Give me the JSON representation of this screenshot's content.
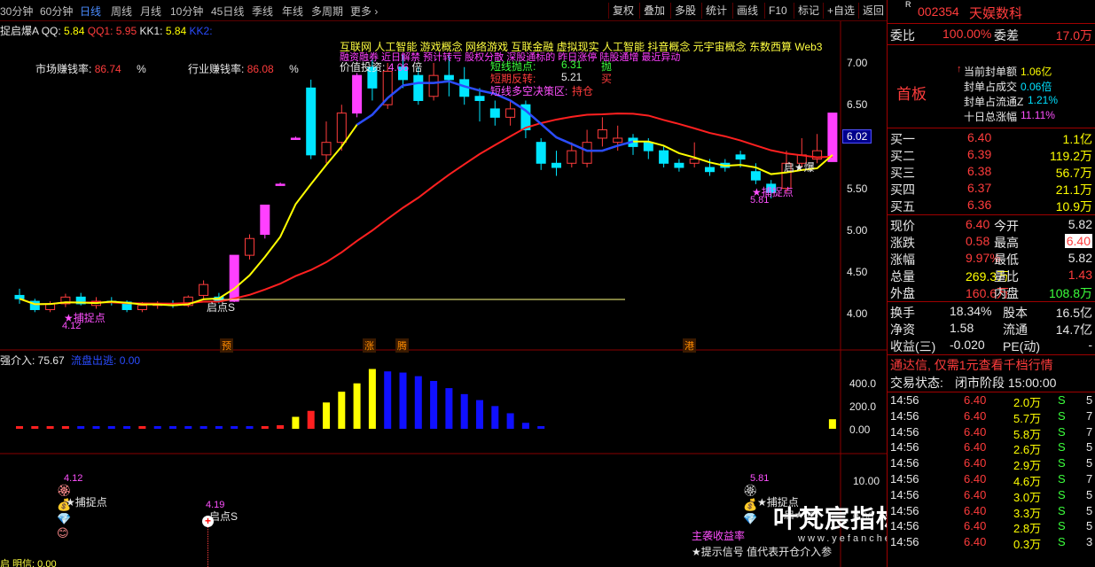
{
  "toolbar": {
    "periods": [
      "30分钟",
      "60分钟",
      "日线",
      "周线",
      "月线",
      "10分钟",
      "45日线",
      "季线",
      "年线",
      "多周期",
      "更多"
    ],
    "buttons": [
      "复权",
      "叠加",
      "多股",
      "统计",
      "画线",
      "F10",
      "标记",
      "+自选",
      "返回"
    ]
  },
  "main_header": {
    "indicator_name": "捉启爆A",
    "qq_label": "QQ:",
    "qq_value": "5.84",
    "qq1_label": "QQ1:",
    "qq1_value": "5.95",
    "kk1_label": "KK1:",
    "kk1_value": "5.84",
    "kk2_label": "KK2:"
  },
  "market": {
    "market_label": "市场赚钱率:",
    "market_value": "86.74",
    "market_unit": "%",
    "industry_label": "行业赚钱率:",
    "industry_value": "86.08",
    "industry_unit": "%"
  },
  "concepts": {
    "line1": "互联网  人工智能  游戏概念  网络游戏  互联金融  虚拟现实  人工智能  抖音概念  元宇宙概念  东数西算  Web3",
    "line2": "融资融券  近日解禁  预计转亏  股权分散  深股通标的  昨日涨停  陆股通增  最近异动",
    "value_label": "价值投资:",
    "value_num": "4.06",
    "value_suffix": "倍"
  },
  "signal_box": {
    "row1_label": "短线抛点:",
    "row1_value": "6.31",
    "row1_tag": "抛",
    "row2_label": "短期反转:",
    "row2_value": "5.21",
    "row2_tag": "买",
    "row3_label": "短线多空决策区:",
    "row3_value": "持仓"
  },
  "price_axis": [
    "7.00",
    "6.50",
    "6.02",
    "5.50",
    "5.00",
    "4.50",
    "4.00"
  ],
  "price_axis_highlight": "6.02",
  "annotations": {
    "catch_point_left": "★捕捉点",
    "catch_point_left_val": "4.12",
    "start_s": "启点S",
    "catch_point_right": "★捕捉点",
    "catch_point_right_val": "5.81",
    "start_burst": "启★爆",
    "markers": [
      "预",
      "涨",
      "腾",
      "港"
    ]
  },
  "volume_panel": {
    "label": "强介入: 75.67",
    "label2": "流盘出逃: 0.00",
    "axis": [
      "400.0",
      "200.0",
      "0.00"
    ]
  },
  "bottom_panel": {
    "left_val": "4.12",
    "left_label": "★捕捉点",
    "mid_val": "4.19",
    "mid_label": "启点S",
    "right_val": "5.81",
    "right_label": "★捕捉点",
    "right_tag": "启★爆",
    "main_profit": "主袭收益率",
    "hint": "★提示信号  值代表开仓介入参",
    "axis": [
      "10.00",
      "0.00"
    ],
    "footer": "启 明信: 0.00",
    "watermark": "叶梵宸指标公式网",
    "watermark_url": "www.yefanchen.com"
  },
  "side": {
    "stock_code": "002354",
    "stock_name": "天娱数科",
    "weibi_label": "委比",
    "weibi_value": "100.00%",
    "weicha_label": "委差",
    "weicha_value": "17.0万",
    "board_label": "首板",
    "current_seal_label": "当前封单额",
    "current_seal_value": "1.06亿",
    "seal_trade_label": "封单占成交",
    "seal_trade_value": "0.06倍",
    "seal_float_label": "封单占流通Z",
    "seal_float_value": "1.21%",
    "ten_day_label": "十日总涨幅",
    "ten_day_value": "11.11%",
    "bids": [
      {
        "label": "买一",
        "price": "6.40",
        "vol": "1.1亿"
      },
      {
        "label": "买二",
        "price": "6.39",
        "vol": "119.2万"
      },
      {
        "label": "买三",
        "price": "6.38",
        "vol": "56.7万"
      },
      {
        "label": "买四",
        "price": "6.37",
        "vol": "21.1万"
      },
      {
        "label": "买五",
        "price": "6.36",
        "vol": "10.9万"
      }
    ],
    "stats": [
      {
        "l1": "现价",
        "v1": "6.40",
        "l2": "今开",
        "v2": "5.82"
      },
      {
        "l1": "涨跌",
        "v1": "0.58",
        "l2": "最高",
        "v2": "6.40"
      },
      {
        "l1": "涨幅",
        "v1": "9.97%",
        "l2": "最低",
        "v2": "5.82"
      },
      {
        "l1": "总量",
        "v1": "269.3万",
        "l2": "量比",
        "v2": "1.43"
      },
      {
        "l1": "外盘",
        "v1": "160.6万",
        "l2": "内盘",
        "v2": "108.8万"
      }
    ],
    "stats2": [
      {
        "l1": "换手",
        "v1": "18.34%",
        "l2": "股本",
        "v2": "16.5亿"
      },
      {
        "l1": "净资",
        "v1": "1.58",
        "l2": "流通",
        "v2": "14.7亿"
      },
      {
        "l1": "收益(三)",
        "v1": "-0.020",
        "l2": "PE(动)",
        "v2": "-"
      }
    ],
    "promo": "通达信, 仅需1元查看千档行情",
    "trade_status_label": "交易状态:",
    "trade_status_value": "闭市阶段 15:00:00",
    "ticks": [
      {
        "time": "14:56",
        "price": "6.40",
        "vol": "2.0万",
        "bs": "S",
        "n": "5"
      },
      {
        "time": "14:56",
        "price": "6.40",
        "vol": "5.7万",
        "bs": "S",
        "n": "7"
      },
      {
        "time": "14:56",
        "price": "6.40",
        "vol": "5.8万",
        "bs": "S",
        "n": "7"
      },
      {
        "time": "14:56",
        "price": "6.40",
        "vol": "2.6万",
        "bs": "S",
        "n": "5"
      },
      {
        "time": "14:56",
        "price": "6.40",
        "vol": "2.9万",
        "bs": "S",
        "n": "5"
      },
      {
        "time": "14:56",
        "price": "6.40",
        "vol": "4.6万",
        "bs": "S",
        "n": "7"
      },
      {
        "time": "14:56",
        "price": "6.40",
        "vol": "3.0万",
        "bs": "S",
        "n": "5"
      },
      {
        "time": "14:56",
        "price": "6.40",
        "vol": "3.3万",
        "bs": "S",
        "n": "5"
      },
      {
        "time": "14:56",
        "price": "6.40",
        "vol": "2.8万",
        "bs": "S",
        "n": "5"
      },
      {
        "time": "14:56",
        "price": "6.40",
        "vol": "0.3万",
        "bs": "S",
        "n": "3"
      }
    ]
  },
  "colors": {
    "bull": "#ff3c3c",
    "bear": "#00e5ff",
    "limit": "#ff40ff",
    "ma_short": "#ffff00",
    "ma_mid": "#2a4cff",
    "ma_long": "#ff2020",
    "panel_border": "#8a0000"
  },
  "candles": [
    {
      "o": 4.22,
      "c": 4.18,
      "h": 4.3,
      "l": 4.12
    },
    {
      "o": 4.15,
      "c": 4.05,
      "h": 4.18,
      "l": 4.02
    },
    {
      "o": 4.05,
      "c": 4.12,
      "h": 4.15,
      "l": 4.02
    },
    {
      "o": 4.12,
      "c": 4.2,
      "h": 4.24,
      "l": 4.08
    },
    {
      "o": 4.2,
      "c": 4.12,
      "h": 4.25,
      "l": 4.1
    },
    {
      "o": 4.1,
      "c": 4.15,
      "h": 4.2,
      "l": 4.06
    },
    {
      "o": 4.15,
      "c": 4.14,
      "h": 4.2,
      "l": 4.1
    },
    {
      "o": 4.14,
      "c": 4.05,
      "h": 4.16,
      "l": 4.02
    },
    {
      "o": 4.05,
      "c": 4.1,
      "h": 4.14,
      "l": 4.02
    },
    {
      "o": 4.1,
      "c": 4.12,
      "h": 4.15,
      "l": 4.06
    },
    {
      "o": 4.12,
      "c": 4.1,
      "h": 4.16,
      "l": 4.07
    },
    {
      "o": 4.1,
      "c": 4.2,
      "h": 4.22,
      "l": 4.08
    },
    {
      "o": 4.22,
      "c": 4.35,
      "h": 4.4,
      "l": 4.18
    },
    {
      "o": 4.2,
      "c": 4.15,
      "h": 4.25,
      "l": 4.12
    },
    {
      "o": 4.15,
      "c": 4.7,
      "h": 4.7,
      "l": 4.14,
      "limit": true
    },
    {
      "o": 4.7,
      "c": 4.9,
      "h": 4.95,
      "l": 4.65
    },
    {
      "o": 4.95,
      "c": 5.3,
      "h": 5.3,
      "l": 4.9,
      "limit": true
    },
    {
      "o": 5.55,
      "c": 5.55,
      "h": 5.57,
      "l": 5.53,
      "limit": true
    },
    {
      "o": 6.1,
      "c": 6.1,
      "h": 6.12,
      "l": 6.08,
      "limit": true
    },
    {
      "o": 6.7,
      "c": 5.9,
      "h": 6.8,
      "l": 5.85
    },
    {
      "o": 5.9,
      "c": 6.05,
      "h": 6.3,
      "l": 5.8
    },
    {
      "o": 6.05,
      "c": 6.4,
      "h": 6.5,
      "l": 5.95
    },
    {
      "o": 6.4,
      "c": 6.85,
      "h": 6.88,
      "l": 6.35,
      "limit": true
    },
    {
      "o": 6.95,
      "c": 6.7,
      "h": 7.05,
      "l": 6.55
    },
    {
      "o": 6.5,
      "c": 6.9,
      "h": 7.0,
      "l": 6.45
    },
    {
      "o": 6.95,
      "c": 6.8,
      "h": 7.1,
      "l": 6.7
    },
    {
      "o": 6.85,
      "c": 6.55,
      "h": 6.95,
      "l": 6.5
    },
    {
      "o": 6.6,
      "c": 6.85,
      "h": 7.0,
      "l": 6.55
    },
    {
      "o": 6.85,
      "c": 6.8,
      "h": 7.1,
      "l": 6.6
    },
    {
      "o": 6.8,
      "c": 6.6,
      "h": 6.95,
      "l": 6.5
    },
    {
      "o": 6.6,
      "c": 6.55,
      "h": 6.7,
      "l": 6.3
    },
    {
      "o": 6.45,
      "c": 6.35,
      "h": 6.55,
      "l": 6.25
    },
    {
      "o": 6.35,
      "c": 6.45,
      "h": 6.55,
      "l": 6.25
    },
    {
      "o": 6.5,
      "c": 6.2,
      "h": 6.55,
      "l": 6.1
    },
    {
      "o": 6.05,
      "c": 5.8,
      "h": 6.1,
      "l": 5.72
    },
    {
      "o": 5.8,
      "c": 5.75,
      "h": 5.95,
      "l": 5.65
    },
    {
      "o": 5.8,
      "c": 5.95,
      "h": 6.05,
      "l": 5.75
    },
    {
      "o": 5.8,
      "c": 6.05,
      "h": 6.2,
      "l": 5.75
    },
    {
      "o": 6.1,
      "c": 6.2,
      "h": 6.35,
      "l": 6.0
    },
    {
      "o": 6.05,
      "c": 6.1,
      "h": 6.25,
      "l": 5.95
    },
    {
      "o": 6.1,
      "c": 6.0,
      "h": 6.15,
      "l": 5.9
    },
    {
      "o": 6.05,
      "c": 5.95,
      "h": 6.1,
      "l": 5.85
    },
    {
      "o": 5.95,
      "c": 5.8,
      "h": 6.0,
      "l": 5.75
    },
    {
      "o": 5.8,
      "c": 5.75,
      "h": 5.85,
      "l": 5.7
    },
    {
      "o": 5.8,
      "c": 5.85,
      "h": 6.05,
      "l": 5.75
    },
    {
      "o": 5.75,
      "c": 5.7,
      "h": 5.85,
      "l": 5.65
    },
    {
      "o": 5.8,
      "c": 5.75,
      "h": 5.85,
      "l": 5.7
    },
    {
      "o": 5.9,
      "c": 5.85,
      "h": 5.95,
      "l": 5.75
    },
    {
      "o": 5.7,
      "c": 5.6,
      "h": 5.8,
      "l": 5.55
    },
    {
      "o": 5.55,
      "c": 5.45,
      "h": 5.6,
      "l": 5.38
    },
    {
      "o": 5.5,
      "c": 5.8,
      "h": 5.95,
      "l": 5.45
    },
    {
      "o": 5.8,
      "c": 5.9,
      "h": 6.1,
      "l": 5.75
    },
    {
      "o": 5.85,
      "c": 5.95,
      "h": 6.15,
      "l": 5.8
    },
    {
      "o": 5.82,
      "c": 6.4,
      "h": 6.4,
      "l": 5.82,
      "limit": true
    }
  ],
  "bars": [
    {
      "v": 20,
      "c": "red"
    },
    {
      "v": 20,
      "c": "red"
    },
    {
      "v": 20,
      "c": "red"
    },
    {
      "v": 20,
      "c": "red"
    },
    {
      "v": 20,
      "c": "blue"
    },
    {
      "v": 20,
      "c": "blue"
    },
    {
      "v": 20,
      "c": "blue"
    },
    {
      "v": 20,
      "c": "blue"
    },
    {
      "v": 20,
      "c": "red"
    },
    {
      "v": 20,
      "c": "blue"
    },
    {
      "v": 20,
      "c": "blue"
    },
    {
      "v": 20,
      "c": "blue"
    },
    {
      "v": 20,
      "c": "blue"
    },
    {
      "v": 20,
      "c": "blue"
    },
    {
      "v": 20,
      "c": "blue"
    },
    {
      "v": 20,
      "c": "blue"
    },
    {
      "v": 20,
      "c": "red"
    },
    {
      "v": 30,
      "c": "red"
    },
    {
      "v": 100,
      "c": "yellow"
    },
    {
      "v": 150,
      "c": "red"
    },
    {
      "v": 220,
      "c": "yellow"
    },
    {
      "v": 310,
      "c": "yellow"
    },
    {
      "v": 380,
      "c": "yellow"
    },
    {
      "v": 500,
      "c": "yellow"
    },
    {
      "v": 480,
      "c": "blue"
    },
    {
      "v": 470,
      "c": "blue"
    },
    {
      "v": 440,
      "c": "blue"
    },
    {
      "v": 400,
      "c": "blue"
    },
    {
      "v": 340,
      "c": "blue"
    },
    {
      "v": 290,
      "c": "blue"
    },
    {
      "v": 240,
      "c": "blue"
    },
    {
      "v": 190,
      "c": "blue"
    },
    {
      "v": 130,
      "c": "blue"
    },
    {
      "v": 50,
      "c": "blue"
    },
    {
      "v": 10,
      "c": "blue"
    },
    {
      "v": 0,
      "c": "none"
    },
    {
      "v": 0,
      "c": "none"
    },
    {
      "v": 0,
      "c": "none"
    },
    {
      "v": 0,
      "c": "none"
    },
    {
      "v": 0,
      "c": "none"
    },
    {
      "v": 0,
      "c": "none"
    },
    {
      "v": 0,
      "c": "none"
    },
    {
      "v": 0,
      "c": "none"
    },
    {
      "v": 0,
      "c": "none"
    },
    {
      "v": 0,
      "c": "none"
    },
    {
      "v": 0,
      "c": "none"
    },
    {
      "v": 0,
      "c": "none"
    },
    {
      "v": 0,
      "c": "none"
    },
    {
      "v": 0,
      "c": "none"
    },
    {
      "v": 0,
      "c": "none"
    },
    {
      "v": 0,
      "c": "none"
    },
    {
      "v": 0,
      "c": "none"
    },
    {
      "v": 0,
      "c": "none"
    },
    {
      "v": 80,
      "c": "yellow"
    }
  ]
}
